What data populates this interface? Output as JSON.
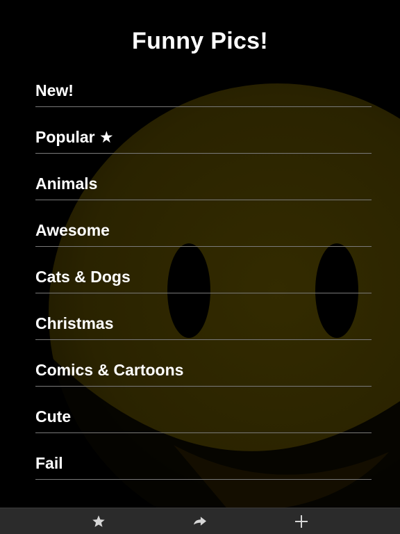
{
  "app": {
    "title": "Funny Pics!"
  },
  "menu": {
    "items": [
      {
        "label": "New!"
      },
      {
        "label": "Popular ★"
      },
      {
        "label": "Animals"
      },
      {
        "label": "Awesome"
      },
      {
        "label": "Cats & Dogs"
      },
      {
        "label": "Christmas"
      },
      {
        "label": "Comics & Cartoons"
      },
      {
        "label": "Cute"
      },
      {
        "label": "Fail"
      }
    ]
  },
  "toolbar": {
    "buttons": [
      {
        "icon": "star-icon"
      },
      {
        "icon": "share-arrow-icon"
      },
      {
        "icon": "plus-icon"
      }
    ]
  },
  "colors": {
    "background": "#000000",
    "smiley": "#2a2300",
    "divider": "#7a7a7a",
    "tabbar": "#2b2b2b",
    "text": "#ffffff"
  }
}
